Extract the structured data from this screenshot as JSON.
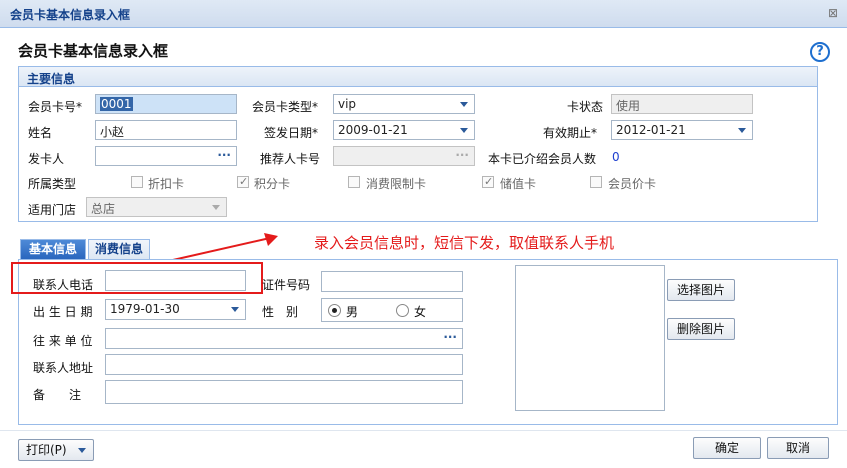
{
  "window": {
    "title": "会员卡基本信息录入框",
    "close_glyph": "⊠"
  },
  "header": {
    "title": "会员卡基本信息录入框",
    "help_glyph": "?"
  },
  "main_section": {
    "title": "主要信息",
    "card_no_label": "会员卡号*",
    "card_no_value": "0001",
    "card_type_label": "会员卡类型*",
    "card_type_value": "vip",
    "card_status_label": "卡状态",
    "card_status_value": "使用",
    "name_label": "姓名",
    "name_value": "小赵",
    "issue_date_label": "签发日期*",
    "issue_date_value": "2009-01-21",
    "expiry_label": "有效期止*",
    "expiry_value": "2012-01-21",
    "issuer_label": "发卡人",
    "issuer_value": "",
    "referrer_label": "推荐人卡号",
    "referrer_value": "",
    "referred_count_label": "本卡已介绍会员人数",
    "referred_count_value": "0",
    "type_label": "所属类型",
    "types": [
      {
        "label": "折扣卡",
        "checked": false
      },
      {
        "label": "积分卡",
        "checked": true
      },
      {
        "label": "消费限制卡",
        "checked": false
      },
      {
        "label": "储值卡",
        "checked": true
      },
      {
        "label": "会员价卡",
        "checked": false
      }
    ],
    "store_label": "适用门店",
    "store_value": "总店"
  },
  "tabs": [
    {
      "label": "基本信息",
      "active": true
    },
    {
      "label": "消费信息",
      "active": false
    }
  ],
  "annotation": {
    "text": "录入会员信息时，短信下发，取值联系人手机",
    "color": "#e41b1b"
  },
  "basic": {
    "phone_label": "联系人电话",
    "phone_value": "",
    "id_label": "证件号码",
    "id_value": "",
    "birth_label": "出 生 日 期",
    "birth_value": "1979-01-30",
    "gender_label": "性　别",
    "gender_options": [
      {
        "label": "男",
        "selected": true
      },
      {
        "label": "女",
        "selected": false
      }
    ],
    "company_label": "往 来 单 位",
    "company_value": "",
    "address_label": "联系人地址",
    "address_value": "",
    "note_label": "备　　注",
    "note_value": ""
  },
  "image_buttons": {
    "select": "选择图片",
    "delete": "删除图片"
  },
  "footer": {
    "print": "打印(P)",
    "ok": "确定",
    "cancel": "取消"
  },
  "colors": {
    "accent": "#15428b",
    "border": "#99bbe8",
    "tab_active": "#2a66be"
  }
}
